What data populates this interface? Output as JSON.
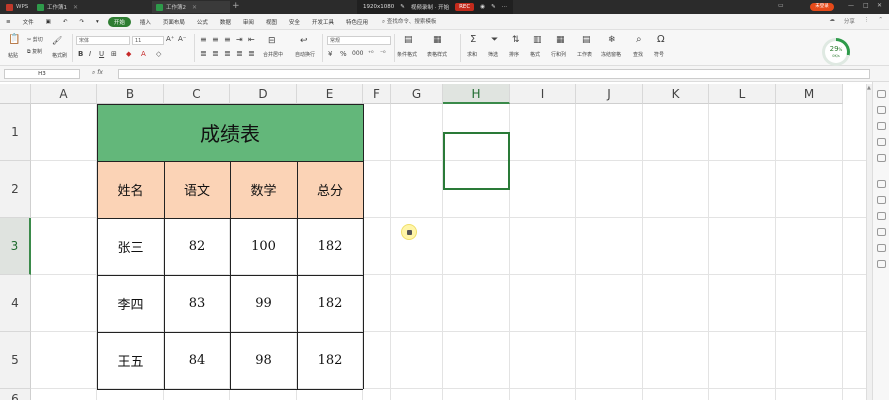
{
  "titlebar": {
    "app_tab": "WPS",
    "doc_tab_1": "工作簿1",
    "doc_tab_2": "工作簿2",
    "resolution": "1920x1080",
    "recording_title": "视频录制 · 开始",
    "rec_label": "REC",
    "user_badge": "未登录",
    "colors": {
      "bg": "#2b2b2b",
      "rec": "#c42b1c"
    }
  },
  "menubar": {
    "file": "文件",
    "tabs": [
      "开始",
      "插入",
      "页面布局",
      "公式",
      "数据",
      "审阅",
      "视图",
      "安全",
      "开发工具",
      "特色应用"
    ],
    "active_tab": "开始",
    "search": "查找命令、搜索模板",
    "share": "分享"
  },
  "ribbon": {
    "paste": "粘贴",
    "cut": "剪切",
    "copy": "复制",
    "format_painter": "格式刷",
    "font_name": "宋体",
    "font_size": "11",
    "merge_center": "合并居中",
    "wrap_text": "自动换行",
    "number_format": "常规",
    "conditional_format": "条件格式",
    "table_style": "表格样式",
    "sum": "求和",
    "filter": "筛选",
    "sort": "排序",
    "format": "格式",
    "row_col": "行和列",
    "worksheet": "工作表",
    "freeze": "冻结窗格",
    "find": "查找",
    "symbol": "符号",
    "progress_value": "29",
    "progress_unit": "%",
    "progress_sub": "0K/s",
    "colors": {
      "accent": "#2e7d32"
    }
  },
  "formulabar": {
    "name_box": "H3",
    "fx": "fx"
  },
  "sheet": {
    "columns": [
      "A",
      "B",
      "C",
      "D",
      "E",
      "F",
      "G",
      "H",
      "I",
      "J",
      "K",
      "L",
      "M"
    ],
    "rows": [
      "1",
      "2",
      "3",
      "4",
      "5",
      "6"
    ],
    "active_column": "H",
    "active_row": "3",
    "title": "成绩表",
    "headers": [
      "姓名",
      "语文",
      "数学",
      "总分"
    ],
    "records": [
      [
        "张三",
        "82",
        "100",
        "182"
      ],
      [
        "李四",
        "83",
        "99",
        "182"
      ],
      [
        "王五",
        "84",
        "98",
        "182"
      ]
    ],
    "colors": {
      "title_fill": "#63b77a",
      "header_fill": "#fbd3b6",
      "selection": "#2a7a38"
    }
  }
}
